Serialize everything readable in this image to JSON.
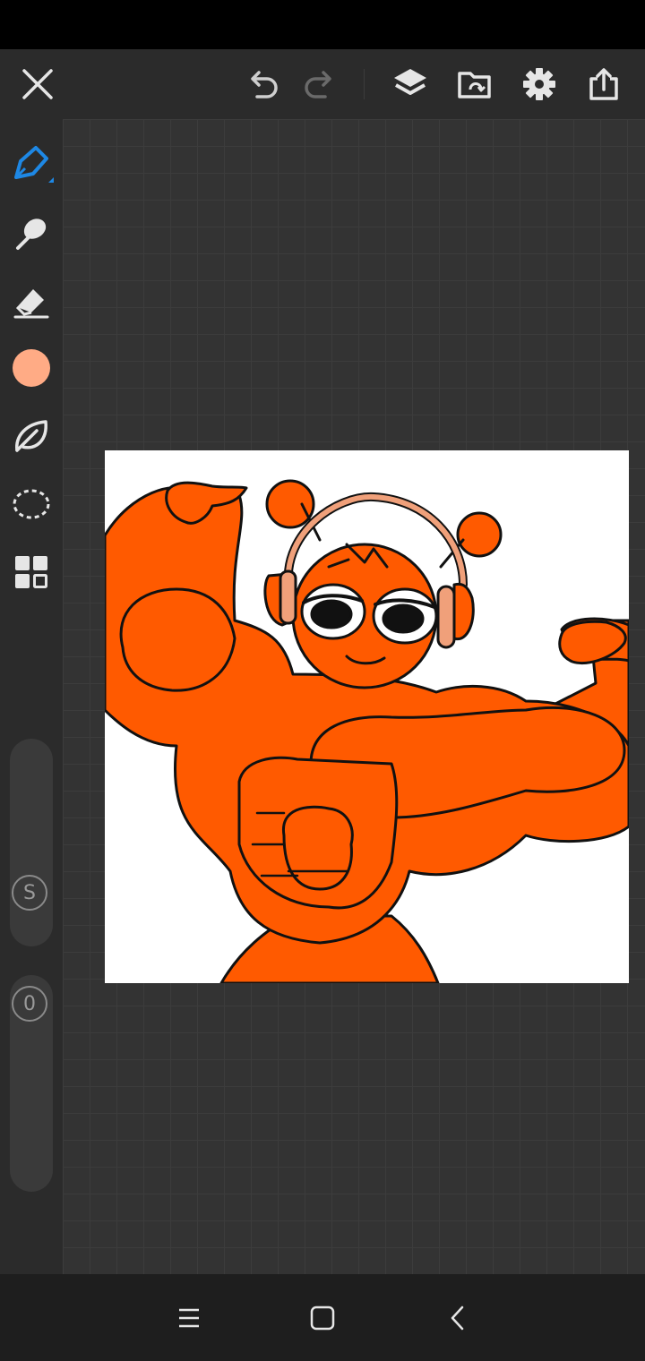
{
  "app": {
    "toolbar": {
      "close_icon": "close-icon",
      "undo_icon": "undo-icon",
      "redo_icon": "redo-icon",
      "layers_icon": "layers-icon",
      "gallery_icon": "gallery-folder-icon",
      "settings_icon": "gear-icon",
      "share_icon": "share-icon"
    },
    "tools": [
      {
        "name": "brush",
        "icon": "pen-icon",
        "active": true
      },
      {
        "name": "smudge",
        "icon": "smudge-icon"
      },
      {
        "name": "eraser",
        "icon": "eraser-icon"
      },
      {
        "name": "color",
        "icon": "color-swatch",
        "color": "#FFAB85"
      },
      {
        "name": "leaf",
        "icon": "leaf-icon"
      },
      {
        "name": "selection",
        "icon": "lasso-icon"
      },
      {
        "name": "gallery",
        "icon": "grid-icon"
      }
    ],
    "size_slider": {
      "label": "S"
    },
    "opacity_slider": {
      "label": "0"
    },
    "colors": {
      "accent": "#1E88E5",
      "character": "#FF5A00",
      "headphone": "#F0A07A"
    }
  }
}
